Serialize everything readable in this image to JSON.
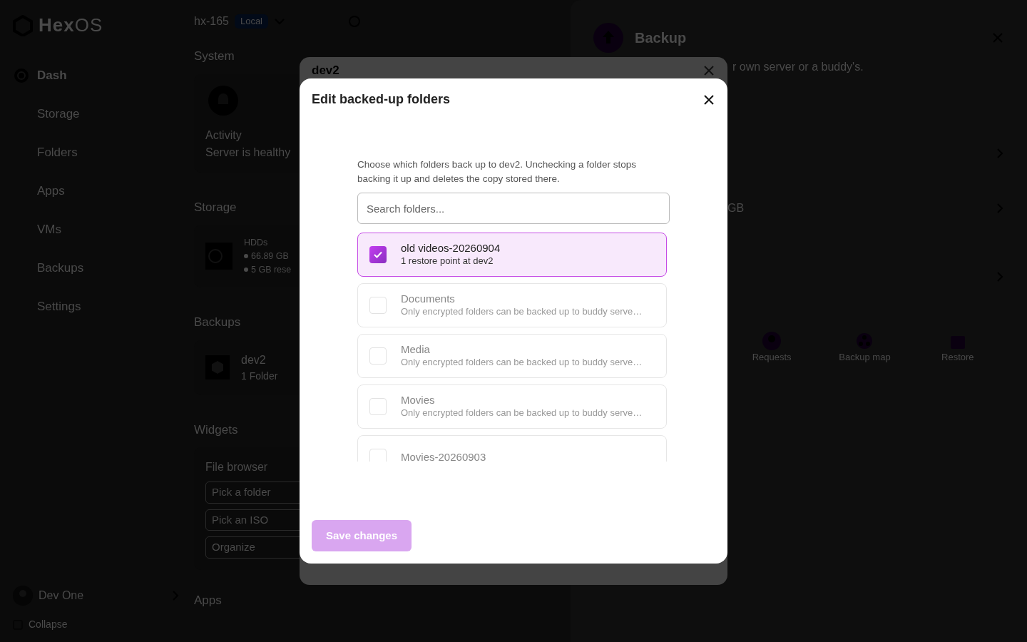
{
  "sidebar": {
    "logo": "**Hex**OS",
    "items": [
      {
        "label": "Dash",
        "selected": true
      },
      {
        "label": "Storage",
        "selected": false
      },
      {
        "label": "Folders",
        "selected": false
      },
      {
        "label": "Apps",
        "selected": false
      },
      {
        "label": "VMs",
        "selected": false
      },
      {
        "label": "Backups",
        "selected": false
      },
      {
        "label": "Settings",
        "selected": false
      }
    ],
    "user": "Dev One",
    "collapse": "Collapse"
  },
  "header": {
    "server": "hx-165",
    "badge": "Local"
  },
  "system": {
    "title": "System",
    "card_title": "Activity",
    "card_status": "Server is healthy"
  },
  "storage": {
    "title": "Storage",
    "card_title": "HDDs",
    "lines": [
      "66.89 GB",
      "5 GB rese"
    ]
  },
  "backups": {
    "title": "Backups",
    "card_title": "dev2",
    "card_detail": "1 Folder"
  },
  "widgets": {
    "title": "Widgets",
    "card_title": "File browser",
    "fields": [
      "Pick a folder",
      "Pick an ISO",
      "Organize"
    ]
  },
  "apps": {
    "title": "Apps"
  },
  "drawer": {
    "title": "Backup",
    "description": "r own server or a buddy's.",
    "row_fragment": "GB",
    "actions": [
      "Requests",
      "Backup map",
      "Restore"
    ]
  },
  "parent_dialog": {
    "title": "dev2"
  },
  "dialog": {
    "title": "Edit backed-up folders",
    "description": "Choose which folders back up to dev2. Unchecking a folder stops backing it up and deletes the copy stored there.",
    "search": {
      "placeholder": "Search folders..."
    },
    "folders": [
      {
        "name": "old videos-20260904",
        "detail": "1 restore point at dev2",
        "checked": true
      },
      {
        "name": "Documents",
        "detail": "Only encrypted folders can be backed up to buddy serve…",
        "checked": false
      },
      {
        "name": "Media",
        "detail": "Only encrypted folders can be backed up to buddy serve…",
        "checked": false
      },
      {
        "name": "Movies",
        "detail": "Only encrypted folders can be backed up to buddy serve…",
        "checked": false
      },
      {
        "name": "Movies-20260903",
        "checked": false
      }
    ],
    "save_button": {
      "label": "Save changes",
      "disabled": true
    }
  }
}
